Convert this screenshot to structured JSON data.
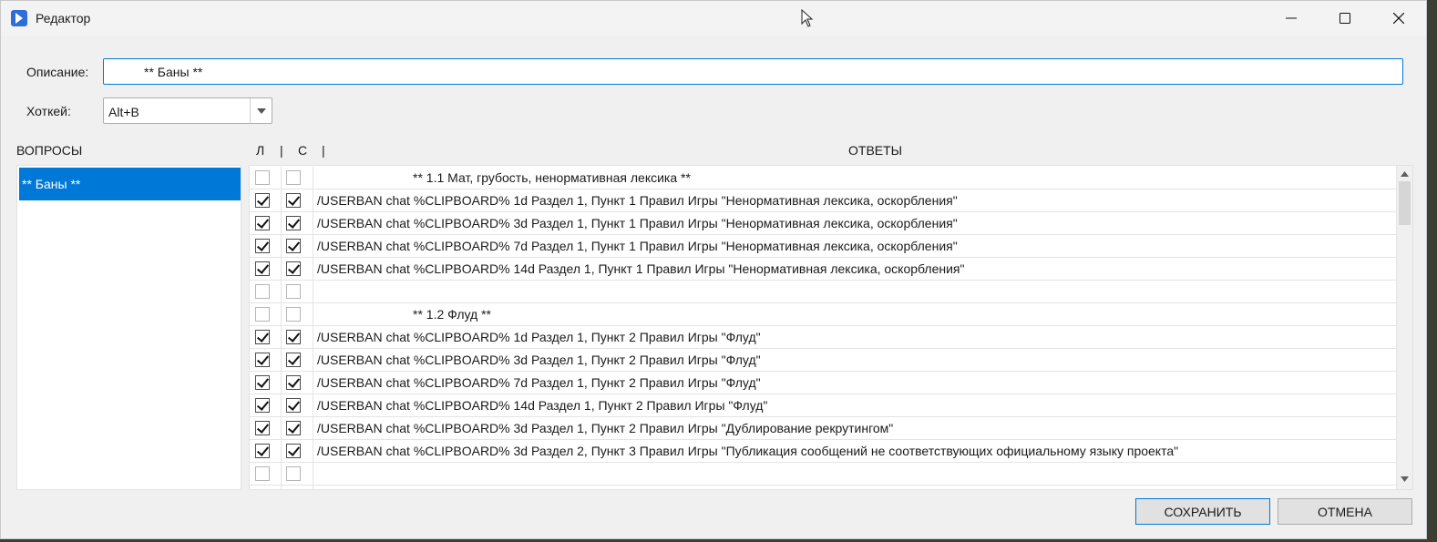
{
  "window": {
    "title": "Редактор"
  },
  "form": {
    "description_label": "Описание:",
    "description_value": "** Баны **",
    "hotkey_label": "Хоткей:",
    "hotkey_value": "Alt+B"
  },
  "columns": {
    "questions": "ВОПРОСЫ",
    "l": "Л",
    "sep1": "|",
    "c": "С",
    "sep2": "|",
    "answers": "ОТВЕТЫ"
  },
  "questions": [
    {
      "label": "** Баны **",
      "selected": true
    }
  ],
  "answers": [
    {
      "l": false,
      "c": false,
      "text": "                           ** 1.1 Мат, грубость, ненормативная лексика **"
    },
    {
      "l": true,
      "c": true,
      "text": "/USERBAN chat %CLIPBOARD% 1d Раздел 1, Пункт 1 Правил Игры \"Ненормативная лексика, оскорбления\""
    },
    {
      "l": true,
      "c": true,
      "text": "/USERBAN chat %CLIPBOARD% 3d Раздел 1, Пункт 1 Правил Игры \"Ненормативная лексика, оскорбления\""
    },
    {
      "l": true,
      "c": true,
      "text": "/USERBAN chat %CLIPBOARD% 7d Раздел 1, Пункт 1 Правил Игры \"Ненормативная лексика, оскорбления\""
    },
    {
      "l": true,
      "c": true,
      "text": "/USERBAN chat %CLIPBOARD% 14d Раздел 1, Пункт 1 Правил Игры \"Ненормативная лексика, оскорбления\""
    },
    {
      "l": false,
      "c": false,
      "text": ""
    },
    {
      "l": false,
      "c": false,
      "text": "                           ** 1.2 Флуд **"
    },
    {
      "l": true,
      "c": true,
      "text": "/USERBAN chat %CLIPBOARD% 1d Раздел 1, Пункт 2 Правил Игры \"Флуд\""
    },
    {
      "l": true,
      "c": true,
      "text": "/USERBAN chat %CLIPBOARD% 3d Раздел 1, Пункт 2 Правил Игры \"Флуд\""
    },
    {
      "l": true,
      "c": true,
      "text": "/USERBAN chat %CLIPBOARD% 7d Раздел 1, Пункт 2 Правил Игры \"Флуд\""
    },
    {
      "l": true,
      "c": true,
      "text": "/USERBAN chat %CLIPBOARD% 14d Раздел 1, Пункт 2 Правил Игры \"Флуд\""
    },
    {
      "l": true,
      "c": true,
      "text": "/USERBAN chat %CLIPBOARD% 3d Раздел 1, Пункт 2 Правил Игры \"Дублирование рекрутингом\""
    },
    {
      "l": true,
      "c": true,
      "text": "/USERBAN chat %CLIPBOARD% 3d Раздел 2, Пункт 3 Правил Игры \"Публикация сообщений не соответствующих официальному языку проекта\""
    },
    {
      "l": false,
      "c": false,
      "text": ""
    },
    {
      "l": false,
      "c": false,
      "text": ""
    }
  ],
  "buttons": {
    "save": "СОХРАНИТЬ",
    "cancel": "ОТМЕНА"
  },
  "colors": {
    "accent": "#0078d7",
    "selection_text": "#ffffff"
  },
  "icons": {
    "app": "app-logo-icon",
    "minimize": "minimize-icon",
    "maximize": "maximize-icon",
    "close": "close-icon",
    "dropdown": "chevron-down-icon",
    "scroll_up": "scroll-up-arrow-icon",
    "scroll_down": "scroll-down-arrow-icon"
  }
}
